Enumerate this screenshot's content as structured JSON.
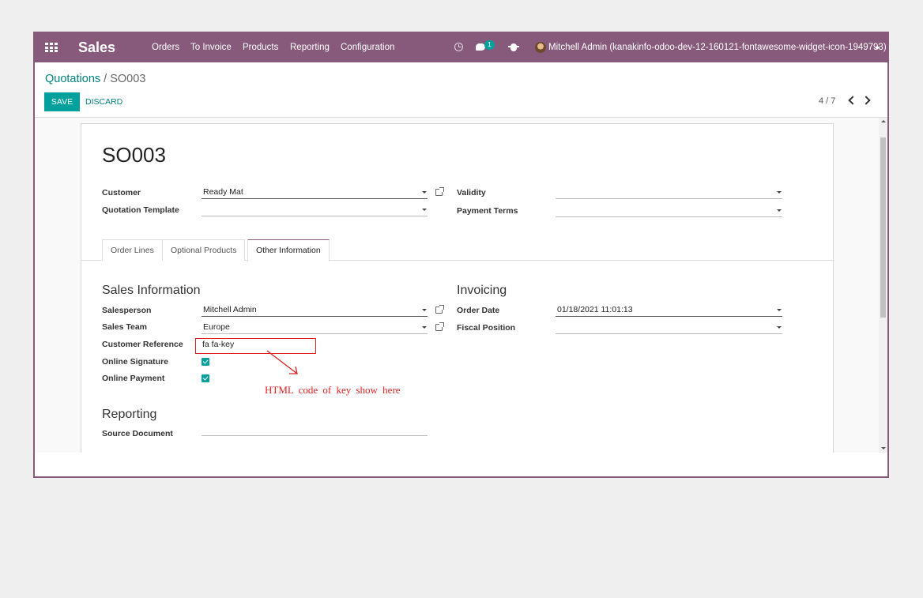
{
  "navbar": {
    "app_name": "Sales",
    "menu": [
      "Orders",
      "To Invoice",
      "Products",
      "Reporting",
      "Configuration"
    ],
    "message_badge": "1",
    "user": "Mitchell Admin (kanakinfo-odoo-dev-12-160121-fontawesome-widget-icon-1949793)",
    "color": "#875a7b",
    "icons": [
      "apps-icon",
      "clock-icon",
      "chat-icon",
      "bug-icon",
      "avatar",
      "chevron-down-icon"
    ]
  },
  "breadcrumb": {
    "parent": "Quotations",
    "separator": "/",
    "current": "SO003"
  },
  "buttons": {
    "save": "SAVE",
    "discard": "DISCARD"
  },
  "pager": {
    "value": "4 / 7"
  },
  "record": {
    "title": "SO003",
    "customer": {
      "label": "Customer",
      "value": "Ready Mat"
    },
    "quotation_template": {
      "label": "Quotation Template",
      "value": ""
    },
    "validity": {
      "label": "Validity",
      "value": ""
    },
    "payment_terms": {
      "label": "Payment Terms",
      "value": ""
    }
  },
  "tabs": [
    {
      "label": "Order Lines",
      "active": false
    },
    {
      "label": "Optional Products",
      "active": false
    },
    {
      "label": "Other Information",
      "active": true
    }
  ],
  "sales_info": {
    "title": "Sales Information",
    "salesperson": {
      "label": "Salesperson",
      "value": "Mitchell Admin"
    },
    "sales_team": {
      "label": "Sales Team",
      "value": "Europe"
    },
    "customer_reference": {
      "label": "Customer Reference",
      "value": "fa fa-key"
    },
    "online_signature": {
      "label": "Online Signature",
      "checked": true
    },
    "online_payment": {
      "label": "Online Payment",
      "checked": true
    }
  },
  "invoicing": {
    "title": "Invoicing",
    "order_date": {
      "label": "Order Date",
      "value": "01/18/2021 11:01:13"
    },
    "fiscal_position": {
      "label": "Fiscal Position",
      "value": ""
    }
  },
  "reporting": {
    "title": "Reporting",
    "source_document": {
      "label": "Source Document",
      "value": ""
    }
  },
  "annotation": {
    "text": "HTML code of key show here",
    "color": "#e02020"
  },
  "accent_color": "#00a09d"
}
